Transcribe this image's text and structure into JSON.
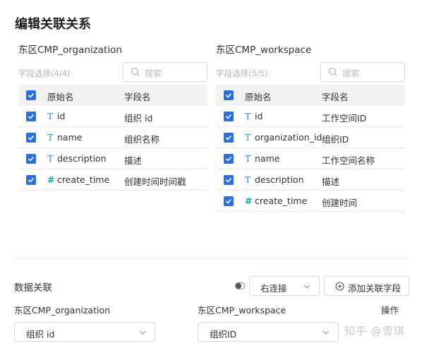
{
  "dialog": {
    "title": "编辑关联关系"
  },
  "left": {
    "name": "东区CMP_organization",
    "select_count": "字段选择(4/4)",
    "search_placeholder": "搜索",
    "head": {
      "orig": "原始名",
      "field": "字段名"
    },
    "rows": [
      {
        "type": "T",
        "orig": "id",
        "field": "组织 id"
      },
      {
        "type": "T",
        "orig": "name",
        "field": "组织名称"
      },
      {
        "type": "T",
        "orig": "description",
        "field": "描述"
      },
      {
        "type": "#",
        "orig": "create_time",
        "field": "创建时间时间戳"
      }
    ]
  },
  "right": {
    "name": "东区CMP_workspace",
    "select_count": "字段选择(5/5)",
    "search_placeholder": "搜索",
    "head": {
      "orig": "原始名",
      "field": "字段名"
    },
    "rows": [
      {
        "type": "T",
        "orig": "id",
        "field": "工作空间ID"
      },
      {
        "type": "T",
        "orig": "organization_id",
        "field": "组织ID"
      },
      {
        "type": "T",
        "orig": "name",
        "field": "工作空间名称"
      },
      {
        "type": "T",
        "orig": "description",
        "field": "描述"
      },
      {
        "type": "#",
        "orig": "create_time",
        "field": "创建时间"
      }
    ]
  },
  "association": {
    "title": "数据关联",
    "join_type": "右连接",
    "add_button": "添加关联字段",
    "left_label": "东区CMP_organization",
    "right_label": "东区CMP_workspace",
    "ops_label": "操作",
    "left_field": "组织 id",
    "right_field": "组织ID"
  },
  "watermark": "知乎 @雪琪",
  "colors": {
    "checkbox": "#2f6fdb",
    "type_text": "#2f8fcf",
    "type_number": "#1aa39a"
  }
}
